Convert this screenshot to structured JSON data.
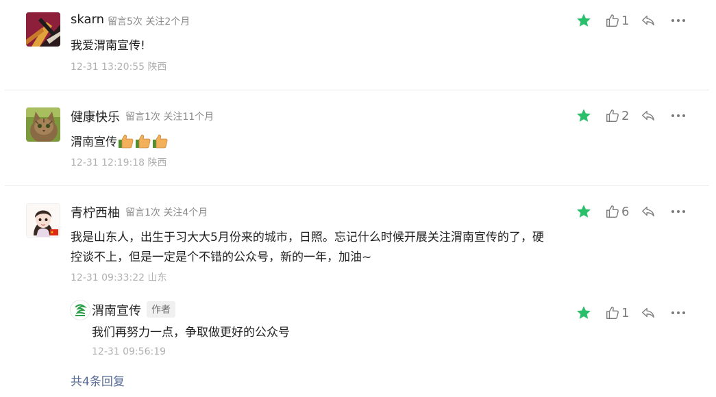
{
  "comments": [
    {
      "nickname": "skarn",
      "meta": "留言5次 关注2个月",
      "content": "我爱渭南宣传!",
      "time": "12-31 13:20:55 陕西",
      "likes": "1",
      "starred": true,
      "avatar_icon": "abstract-avatar"
    },
    {
      "nickname": "健康快乐",
      "meta": "留言1次 关注11个月",
      "content": "渭南宣传",
      "emoji_count": 3,
      "emoji_icon": "thumbs-up-emoji",
      "time": "12-31 12:19:18 陕西",
      "likes": "2",
      "starred": true,
      "avatar_icon": "cat-avatar"
    },
    {
      "nickname": "青柠西柚",
      "meta": "留言1次 关注4个月",
      "content_line1": "我是山东人，出生于习大大5月份来的城市，日照。忘记什么时候开展关注渭南宣传的了，硬",
      "content_line2": "控谈不上，但是一定是个不错的公众号，新的一年，加油~",
      "time": "12-31 09:33:22 山东",
      "likes": "6",
      "starred": true,
      "avatar_icon": "girl-avatar",
      "reply": {
        "nickname": "渭南宣传",
        "badge": "作者",
        "content": "我们再努力一点，争取做更好的公众号",
        "time": "12-31 09:56:19",
        "likes": "1",
        "starred": true,
        "avatar_icon": "weinan-logo"
      },
      "more_replies": "共4条回复"
    }
  ],
  "colors": {
    "star": "#2ac06b",
    "link": "#576b95",
    "icon": "#7a7a7a"
  }
}
